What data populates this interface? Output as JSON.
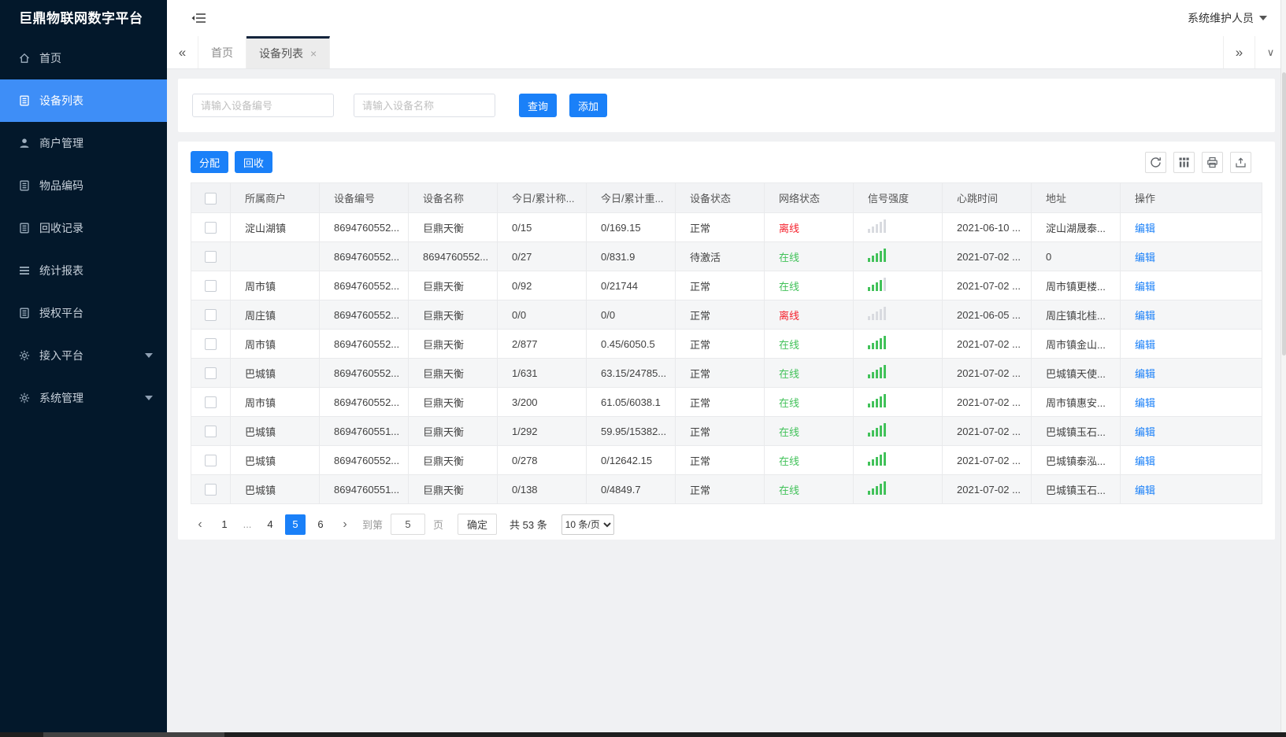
{
  "app": {
    "logo": "巨鼎物联网数字平台",
    "user_role": "系统维护人员"
  },
  "colors": {
    "accent": "#1a80f8",
    "sidebar_active": "#3e8ef7",
    "online": "#42c25a",
    "offline": "#f5222d"
  },
  "sidebar": {
    "items": [
      {
        "label": "首页",
        "icon": "home-icon"
      },
      {
        "label": "设备列表",
        "icon": "document-icon",
        "active": true
      },
      {
        "label": "商户管理",
        "icon": "user-icon"
      },
      {
        "label": "物品编码",
        "icon": "document-icon"
      },
      {
        "label": "回收记录",
        "icon": "document-icon"
      },
      {
        "label": "统计报表",
        "icon": "list-icon"
      },
      {
        "label": "授权平台",
        "icon": "document-icon"
      },
      {
        "label": "接入平台",
        "icon": "gear-icon",
        "expandable": true
      },
      {
        "label": "系统管理",
        "icon": "gear-icon",
        "expandable": true
      }
    ]
  },
  "tabs": {
    "collapse_all": "«",
    "expand_all": "»",
    "overflow_icon": "∨",
    "items": [
      {
        "label": "首页",
        "active": false
      },
      {
        "label": "设备列表",
        "active": true,
        "close": "×"
      }
    ]
  },
  "search": {
    "device_no_placeholder": "请输入设备编号",
    "device_name_placeholder": "请输入设备名称",
    "query_label": "查询",
    "add_label": "添加"
  },
  "toolbar": {
    "assign_label": "分配",
    "recycle_label": "回收"
  },
  "table": {
    "headers": [
      "所属商户",
      "设备编号",
      "设备名称",
      "今日/累计称...",
      "今日/累计重...",
      "设备状态",
      "网络状态",
      "信号强度",
      "心跳时间",
      "地址",
      "操作"
    ],
    "edit_label": "编辑",
    "online_label": "在线",
    "offline_label": "离线",
    "rows": [
      {
        "merchant": "淀山湖镇",
        "device_no": "8694760552...",
        "device_name": "巨鼎天衡",
        "today_count": "0/15",
        "today_weight": "0/169.15",
        "device_status": "正常",
        "network_status": "离线",
        "signal_level": 0,
        "heartbeat": "2021-06-10 ...",
        "address": "淀山湖晟泰..."
      },
      {
        "merchant": "",
        "device_no": "8694760552...",
        "device_name": "8694760552...",
        "today_count": "0/27",
        "today_weight": "0/831.9",
        "device_status": "待激活",
        "network_status": "在线",
        "signal_level": 5,
        "heartbeat": "2021-07-02 ...",
        "address": "0"
      },
      {
        "merchant": "周市镇",
        "device_no": "8694760552...",
        "device_name": "巨鼎天衡",
        "today_count": "0/92",
        "today_weight": "0/21744",
        "device_status": "正常",
        "network_status": "在线",
        "signal_level": 4,
        "heartbeat": "2021-07-02 ...",
        "address": "周市镇更楼..."
      },
      {
        "merchant": "周庄镇",
        "device_no": "8694760552...",
        "device_name": "巨鼎天衡",
        "today_count": "0/0",
        "today_weight": "0/0",
        "device_status": "正常",
        "network_status": "离线",
        "signal_level": 0,
        "heartbeat": "2021-06-05 ...",
        "address": "周庄镇北桂..."
      },
      {
        "merchant": "周市镇",
        "device_no": "8694760552...",
        "device_name": "巨鼎天衡",
        "today_count": "2/877",
        "today_weight": "0.45/6050.5",
        "device_status": "正常",
        "network_status": "在线",
        "signal_level": 5,
        "heartbeat": "2021-07-02 ...",
        "address": "周市镇金山..."
      },
      {
        "merchant": "巴城镇",
        "device_no": "8694760552...",
        "device_name": "巨鼎天衡",
        "today_count": "1/631",
        "today_weight": "63.15/24785...",
        "device_status": "正常",
        "network_status": "在线",
        "signal_level": 5,
        "heartbeat": "2021-07-02 ...",
        "address": "巴城镇天使..."
      },
      {
        "merchant": "周市镇",
        "device_no": "8694760552...",
        "device_name": "巨鼎天衡",
        "today_count": "3/200",
        "today_weight": "61.05/6038.1",
        "device_status": "正常",
        "network_status": "在线",
        "signal_level": 5,
        "heartbeat": "2021-07-02 ...",
        "address": "周市镇惠安..."
      },
      {
        "merchant": "巴城镇",
        "device_no": "8694760551...",
        "device_name": "巨鼎天衡",
        "today_count": "1/292",
        "today_weight": "59.95/15382...",
        "device_status": "正常",
        "network_status": "在线",
        "signal_level": 5,
        "heartbeat": "2021-07-02 ...",
        "address": "巴城镇玉石..."
      },
      {
        "merchant": "巴城镇",
        "device_no": "8694760552...",
        "device_name": "巨鼎天衡",
        "today_count": "0/278",
        "today_weight": "0/12642.15",
        "device_status": "正常",
        "network_status": "在线",
        "signal_level": 5,
        "heartbeat": "2021-07-02 ...",
        "address": "巴城镇泰泓..."
      },
      {
        "merchant": "巴城镇",
        "device_no": "8694760551...",
        "device_name": "巨鼎天衡",
        "today_count": "0/138",
        "today_weight": "0/4849.7",
        "device_status": "正常",
        "network_status": "在线",
        "signal_level": 5,
        "heartbeat": "2021-07-02 ...",
        "address": "巴城镇玉石..."
      }
    ]
  },
  "pagination": {
    "prev": "‹",
    "next": "›",
    "pages": [
      "1",
      "...",
      "4",
      "5",
      "6"
    ],
    "active_page": "5",
    "goto_prefix": "到第",
    "goto_value": "5",
    "goto_suffix": "页",
    "confirm_label": "确定",
    "total_text": "共 53 条",
    "page_size": "10 条/页"
  }
}
